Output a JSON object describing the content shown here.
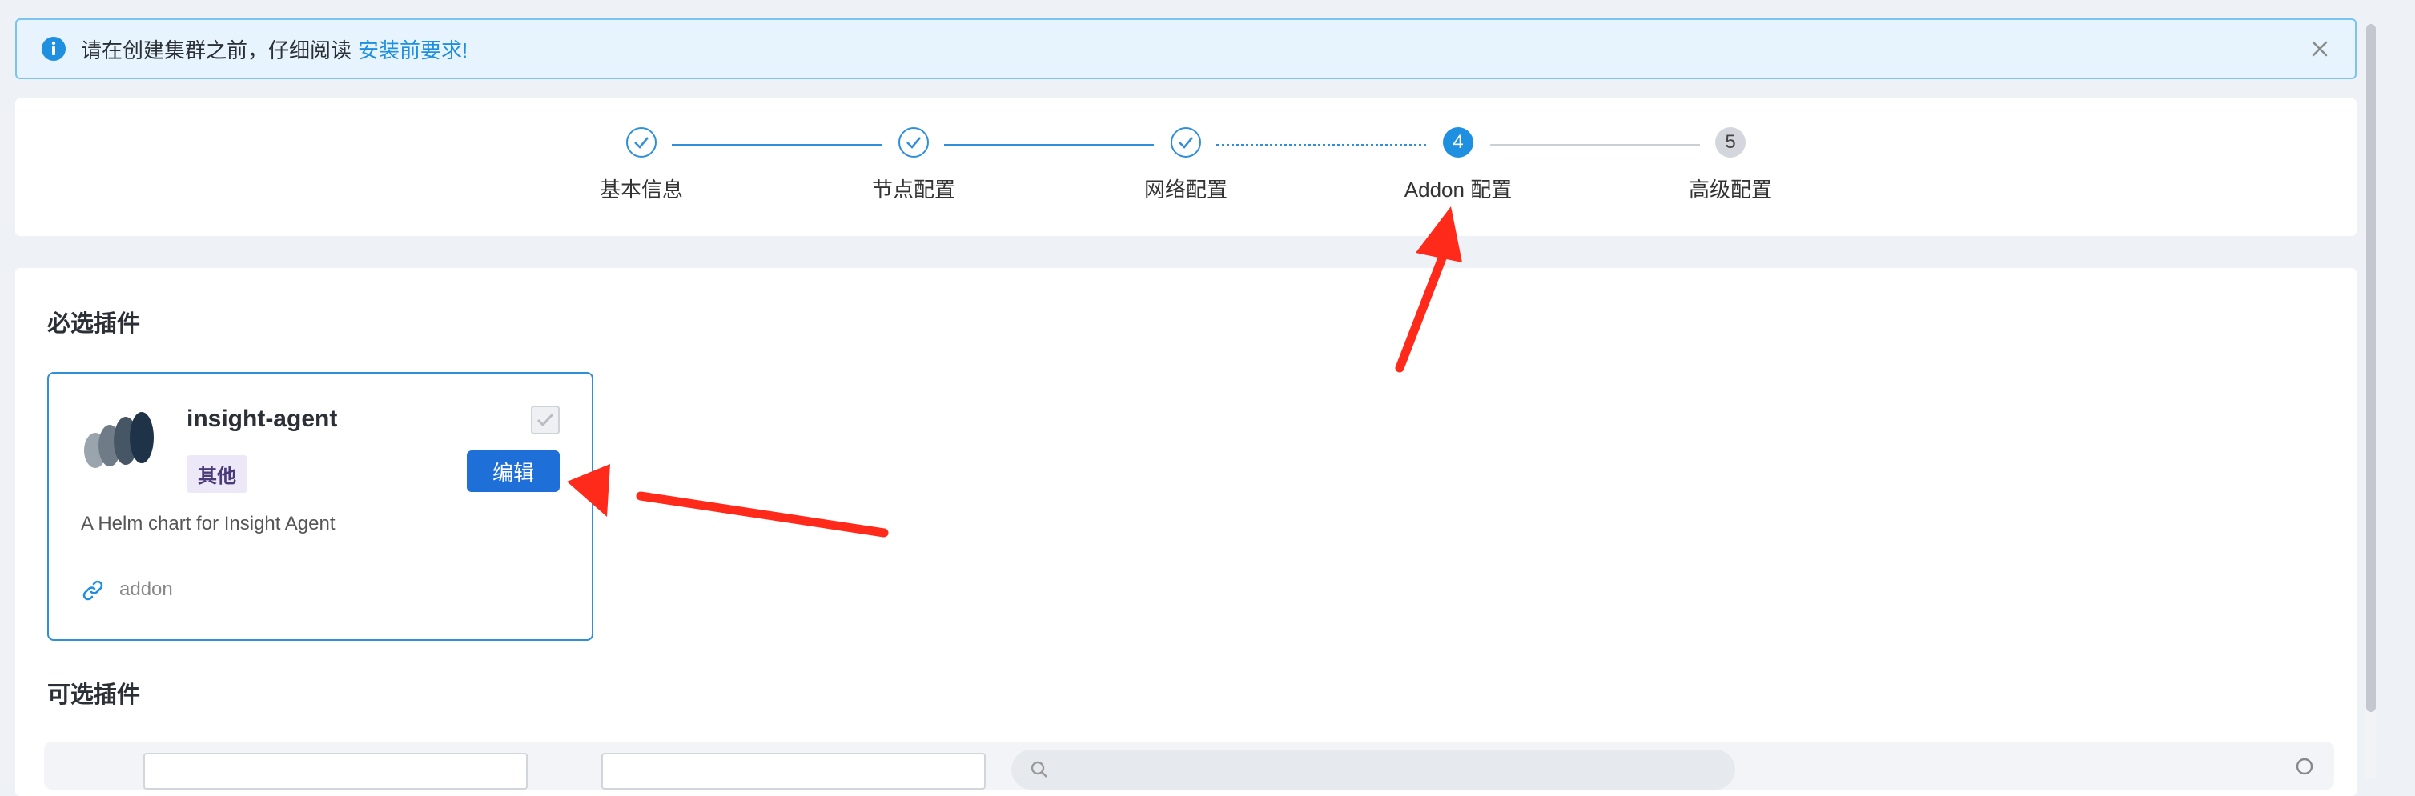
{
  "alert": {
    "text": "请在创建集群之前，仔细阅读",
    "link": "安装前要求!"
  },
  "steps": [
    {
      "label": "基本信息",
      "status": "done"
    },
    {
      "label": "节点配置",
      "status": "done"
    },
    {
      "label": "网络配置",
      "status": "done"
    },
    {
      "label": "Addon 配置",
      "status": "active",
      "number": "4"
    },
    {
      "label": "高级配置",
      "status": "pending",
      "number": "5"
    }
  ],
  "required_section": {
    "title": "必选插件",
    "plugin": {
      "name": "insight-agent",
      "tag": "其他",
      "edit_label": "编辑",
      "description": "A Helm chart for Insight Agent",
      "link": "addon",
      "checked": true,
      "disabled": true,
      "logo_icon": "insight-logo-icon"
    }
  },
  "optional_section": {
    "title": "可选插件"
  },
  "colors": {
    "primary": "#1f8fe0",
    "button": "#1f6fd9",
    "annotation_arrow": "#ff2a1a"
  }
}
